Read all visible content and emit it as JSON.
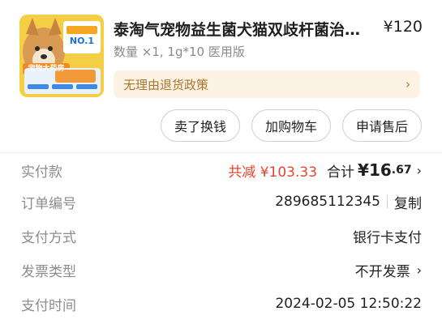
{
  "product": {
    "title": "泰淘气宠物益生菌犬猫双歧杆菌治疗…",
    "price": "¥120",
    "spec": "数量 ×1, 1g*10 医用版",
    "image_caption": "宠物大药房",
    "image_badge": "NO.1"
  },
  "policy": {
    "label": "无理由退货政策",
    "chevron": "›"
  },
  "actions": [
    {
      "label": "卖了换钱"
    },
    {
      "label": "加购物车"
    },
    {
      "label": "申请售后"
    }
  ],
  "order": {
    "paid": {
      "label": "实付款",
      "discount": "共减 ¥103.33",
      "total_label": "合计",
      "total_currency": "¥",
      "total_major": "16",
      "total_minor": ".67",
      "chevron": "›"
    },
    "number": {
      "label": "订单编号",
      "value": "289685112345",
      "copy_label": "复制"
    },
    "payment": {
      "label": "支付方式",
      "value": "银行卡支付"
    },
    "invoice": {
      "label": "发票类型",
      "value": "不开发票",
      "chevron": "›"
    },
    "paytime": {
      "label": "支付时间",
      "value": "2024-02-05 12:50:22"
    }
  },
  "colors": {
    "discount": "#e6452e",
    "policy_bg": "#fdf3e4",
    "policy_text": "#a9762d",
    "label_gray": "#8c8c8c"
  }
}
